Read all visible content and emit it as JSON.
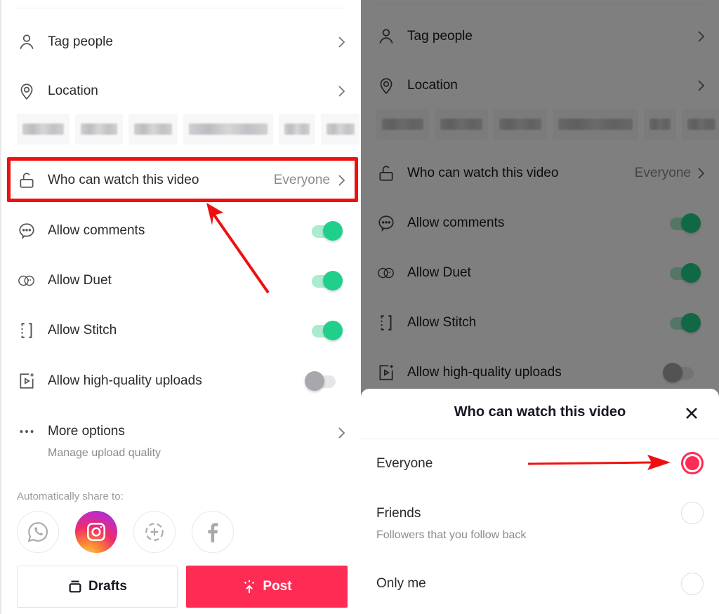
{
  "left_panel": {
    "rows": {
      "tag_people": {
        "label": "Tag people",
        "icon": "person-icon"
      },
      "location": {
        "label": "Location",
        "icon": "location-pin-icon"
      },
      "who_can_watch": {
        "label": "Who can watch this video",
        "value": "Everyone",
        "icon": "unlock-icon"
      },
      "allow_comments": {
        "label": "Allow comments",
        "icon": "comment-icon",
        "enabled": true
      },
      "allow_duet": {
        "label": "Allow Duet",
        "icon": "duet-icon",
        "enabled": true
      },
      "allow_stitch": {
        "label": "Allow Stitch",
        "icon": "stitch-icon",
        "enabled": true
      },
      "allow_hq_uploads": {
        "label": "Allow high-quality uploads",
        "icon": "hq-video-icon",
        "enabled": false
      },
      "more_options": {
        "label": "More options",
        "sublabel": "Manage upload quality",
        "icon": "more-dots-icon"
      }
    },
    "location_tags_count": 6,
    "share": {
      "label": "Automatically share to:",
      "targets": [
        "WhatsApp",
        "Instagram",
        "Add story",
        "Facebook"
      ],
      "selected": "Instagram"
    },
    "buttons": {
      "drafts": "Drafts",
      "post": "Post"
    }
  },
  "right_panel": {
    "rows": {
      "tag_people": {
        "label": "Tag people"
      },
      "location": {
        "label": "Location"
      },
      "who_can_watch": {
        "label": "Who can watch this video",
        "value": "Everyone"
      },
      "allow_comments": {
        "label": "Allow comments",
        "enabled": true
      },
      "allow_duet": {
        "label": "Allow Duet",
        "enabled": true
      },
      "allow_stitch": {
        "label": "Allow Stitch",
        "enabled": true
      },
      "allow_hq_uploads": {
        "label": "Allow high-quality uploads",
        "enabled": false
      }
    },
    "sheet": {
      "title": "Who can watch this video",
      "options": [
        {
          "label": "Everyone",
          "sublabel": "",
          "selected": true
        },
        {
          "label": "Friends",
          "sublabel": "Followers that you follow back",
          "selected": false
        },
        {
          "label": "Only me",
          "sublabel": "",
          "selected": false
        }
      ]
    }
  },
  "colors": {
    "accent": "#fe2c55",
    "toggle_on": "#20d08a",
    "annotation": "#ee1010"
  }
}
